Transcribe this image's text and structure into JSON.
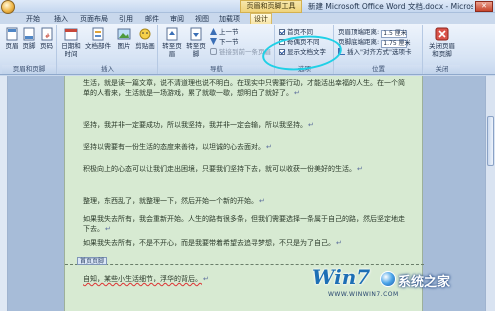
{
  "window": {
    "context_tab_title": "页眉和页脚工具",
    "doc_title": "新建 Microsoft Office Word 文档.docx - Microsoft W...",
    "close_glyph": "✕"
  },
  "tabs": [
    "开始",
    "插入",
    "页面布局",
    "引用",
    "邮件",
    "审阅",
    "视图",
    "加载项",
    "设计"
  ],
  "ribbon": {
    "groups": {
      "header_footer": {
        "label": "页眉和页脚",
        "buttons": [
          "页眉",
          "页脚",
          "页码"
        ]
      },
      "insert": {
        "label": "插入",
        "buttons": [
          "日期和\n时间",
          "文档部件",
          "图片",
          "剪贴画"
        ]
      },
      "navigation": {
        "label": "导航",
        "buttons": [
          "转至页眉",
          "转至页脚"
        ],
        "small": [
          "上一节",
          "下一节",
          "链接到前一条页眉"
        ]
      },
      "options": {
        "label": "选项",
        "checkboxes": [
          {
            "label": "首页不同",
            "checked": true
          },
          {
            "label": "奇偶页不同",
            "checked": false
          },
          {
            "label": "显示文档文字",
            "checked": true
          }
        ]
      },
      "position": {
        "label": "位置",
        "rows": [
          {
            "label": "页眉顶端距离:",
            "value": "1.5 厘米"
          },
          {
            "label": "页脚底端距离:",
            "value": "1.75 厘米"
          },
          {
            "label": "插入\"对齐方式\"选项卡"
          }
        ]
      },
      "close": {
        "label": "关闭",
        "button": "关闭页眉\n和页脚"
      }
    }
  },
  "document": {
    "paragraphs": [
      "生活，就是读一篇文章，说不清道理也说不明白。在现实中只需要行动，才能活出幸福的人生。在一个简单的人看来，生活就是一场游戏，累了就歇一歇，想明白了就好了。",
      "坚持，我并非一定要成功，所以我坚持，我并非一定会输，所以我坚持。",
      "坚持以需要有一份生活的态度来善待，以坦诚的心去面对。",
      "积极向上的心态可以让我们走出困境，只要我们坚持下去，就可以收获一份美好的生活。",
      "整理，东西乱了，就整理一下，然后开始一个新的开始。",
      "如果我失去所有，我会重新开始。人生的路有很多条，但我们需要选择一条属于自己的路，然后坚定地走下去。",
      "如果我失去所有，不是不开心，而是我要带着希望去追寻梦想，不只是为了自己。",
      "自知，某些小生活细节，浮华的背后。"
    ],
    "para_mark": "↵",
    "footer_tag": "首页页脚"
  },
  "watermark": {
    "logo": "Win7",
    "text": "系统之家",
    "subtext": "WWW.WINWIN7.COM"
  }
}
